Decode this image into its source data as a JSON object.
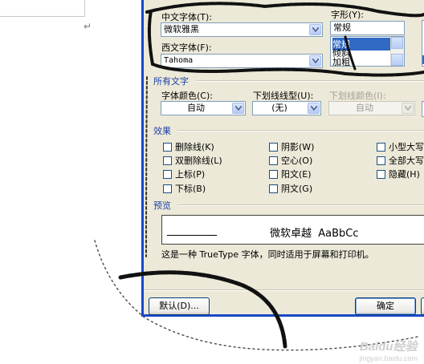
{
  "font_section": {
    "chinese_font_label": "中文字体(T):",
    "chinese_font_value": "微软雅黑",
    "western_font_label": "西文字体(F):",
    "western_font_value": "Tahoma",
    "style_label": "字形(Y):",
    "style_value": "常规",
    "style_options": [
      "常规",
      "倾斜",
      "加粗"
    ]
  },
  "all_text_section": {
    "title": "所有文字",
    "font_color_label": "字体颜色(C):",
    "font_color_value": "自动",
    "underline_type_label": "下划线线型(U):",
    "underline_type_value": "(无)",
    "underline_color_label": "下划线颜色(I):",
    "underline_color_value": "自动"
  },
  "effects_section": {
    "title": "效果",
    "col1": [
      "删除线(K)",
      "双删除线(L)",
      "上标(P)",
      "下标(B)"
    ],
    "col2": [
      "阴影(W)",
      "空心(O)",
      "阳文(E)",
      "阴文(G)"
    ],
    "col3": [
      "小型大写",
      "全部大写",
      "隐藏(H)"
    ]
  },
  "preview_section": {
    "title": "预览",
    "sample_text": "微软卓越  AaBbCc",
    "description": "这是一种 TrueType 字体，同时适用于屏幕和打印机。"
  },
  "buttons": {
    "default_label": "默认(D)...",
    "ok_label": "确定"
  },
  "watermark": {
    "logo": "Baidu经验",
    "url": "jingyan.baidu.com"
  },
  "colors": {
    "dialog_bg": "#ece9d8",
    "dialog_border": "#1848c8",
    "section_title": "#1c3fa8",
    "selection": "#316ac5"
  }
}
